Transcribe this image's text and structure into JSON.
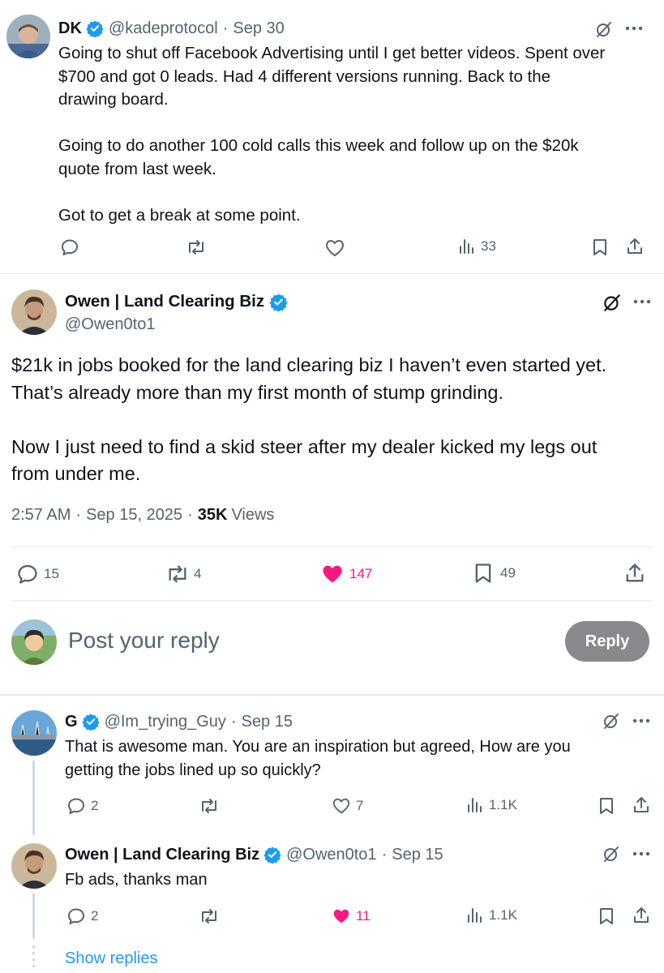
{
  "colors": {
    "accent": "#1d9bf0",
    "like": "#f91880",
    "muted": "#536471",
    "reply_button_bg": "#87898c"
  },
  "tweet1": {
    "name": "DK",
    "handle": "@kadeprotocol",
    "sep": "·",
    "date": "Sep 30",
    "text": "Going to shut off Facebook Advertising until I get better videos. Spent over\n$700 and got 0 leads. Had 4 different versions running. Back to the\ndrawing board.\n\nGoing to do another 100 cold calls this week and follow up on the $20k\nquote from last week.\n\nGot to get a break at some point.",
    "views": "33"
  },
  "main": {
    "name": "Owen | Land Clearing Biz",
    "handle": "@Owen0to1",
    "text": "$21k in jobs booked for the land clearing biz I haven’t even started yet.\nThat’s already more than my first month of stump grinding.\n\nNow I just need to find a skid steer after my dealer kicked my legs out\nfrom under me.",
    "time": "2:57 AM",
    "date": "Sep 15, 2025",
    "views_count": "35K",
    "views_label": "Views",
    "replies": "15",
    "reposts": "4",
    "likes": "147",
    "bookmarks": "49"
  },
  "compose": {
    "placeholder": "Post your reply",
    "button": "Reply"
  },
  "reply1": {
    "name": "G",
    "handle": "@Im_trying_Guy",
    "date": "Sep 15",
    "text": "That is awesome man. You are an inspiration but agreed, How are you\ngetting the jobs lined up so quickly?",
    "replies": "2",
    "likes": "7",
    "views": "1.1K"
  },
  "reply2": {
    "name": "Owen | Land Clearing Biz",
    "handle": "@Owen0to1",
    "date": "Sep 15",
    "text": "Fb ads, thanks man",
    "replies": "2",
    "likes": "11",
    "views": "1.1K"
  },
  "show_replies": "Show replies",
  "icons": [
    "verified-badge-icon",
    "grok-icon",
    "more-icon",
    "reply-icon",
    "repost-icon",
    "like-icon",
    "views-icon",
    "bookmark-icon",
    "share-icon"
  ]
}
